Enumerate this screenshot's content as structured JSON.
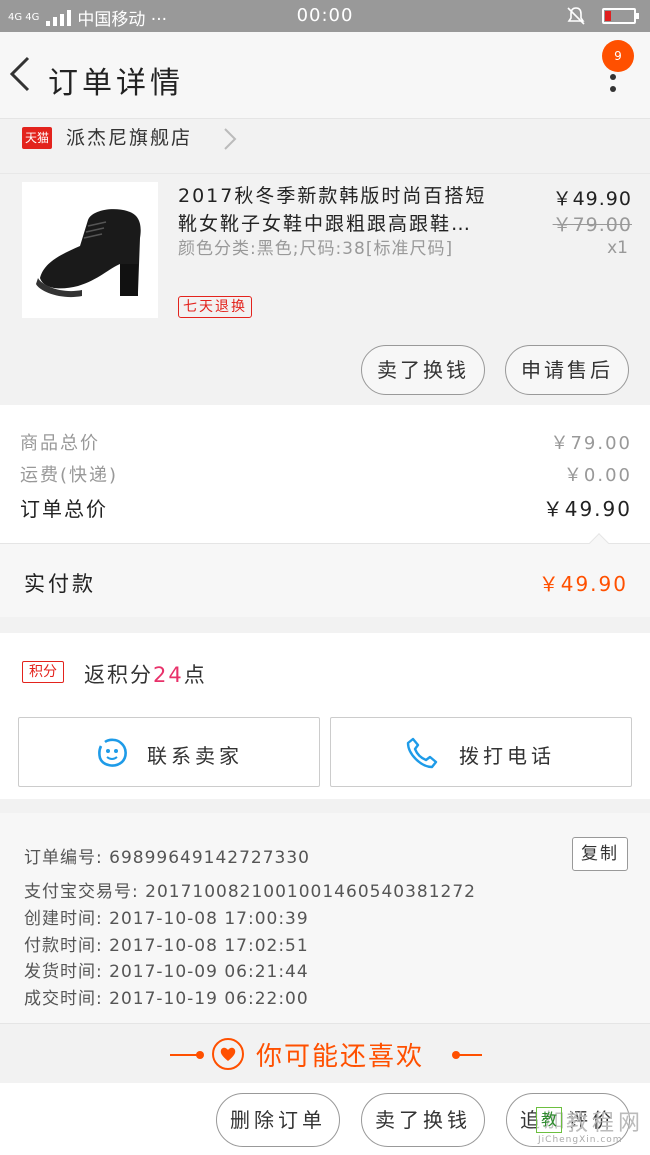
{
  "status_bar": {
    "network": "4G 4G",
    "carrier": "中国移动 ···",
    "time": "00:00"
  },
  "header": {
    "title": "订单详情",
    "badge_count": "9"
  },
  "shop": {
    "badge": "天猫",
    "name": "派杰尼旗舰店"
  },
  "product": {
    "title": "2017秋冬季新款韩版时尚百搭短靴女靴子女鞋中跟粗跟高跟鞋…",
    "spec": "颜色分类:黑色;尺码:38[标准尺码]",
    "return_tag": "七天退换",
    "price": "￥49.90",
    "original_price": "￥79.00",
    "quantity": "x1",
    "btn_sell": "卖了换钱",
    "btn_aftersale": "申请售后"
  },
  "costs": {
    "goods_label": "商品总价",
    "goods_value": "￥79.00",
    "shipping_label": "运费(快递)",
    "shipping_value": "￥0.00",
    "total_label": "订单总价",
    "total_value": "￥49.90"
  },
  "payment": {
    "label": "实付款",
    "value": "￥49.90"
  },
  "points": {
    "badge": "积分",
    "prefix": "返积分",
    "count": "24",
    "suffix": "点",
    "contact_label": "联系卖家",
    "call_label": "拨打电话"
  },
  "order_info": {
    "order_no": "订单编号: 69899649142727330",
    "copy_label": "复制",
    "alipay_no": "支付宝交易号: 2017100821001001460540381272",
    "created": "创建时间: 2017-10-08  17:00:39",
    "paid": "付款时间: 2017-10-08  17:02:51",
    "shipped": "发货时间: 2017-10-09  06:21:44",
    "closed": "成交时间: 2017-10-19  06:22:00"
  },
  "recommend": {
    "title": "你可能还喜欢"
  },
  "actions": {
    "delete": "删除订单",
    "sell": "卖了换钱",
    "review": "追加评价"
  },
  "watermark": {
    "text": "教程网",
    "url": "JiChengXin.com"
  },
  "colors": {
    "accent": "#ff5000",
    "tmall_red": "#e3231d",
    "points_pink": "#e8316a",
    "contact_blue": "#1e9be8"
  },
  "icons": [
    "back-arrow-icon",
    "more-vertical-icon",
    "chevron-right-icon",
    "chat-face-icon",
    "phone-icon",
    "heart-icon",
    "mute-icon",
    "battery-icon",
    "signal-icon"
  ]
}
